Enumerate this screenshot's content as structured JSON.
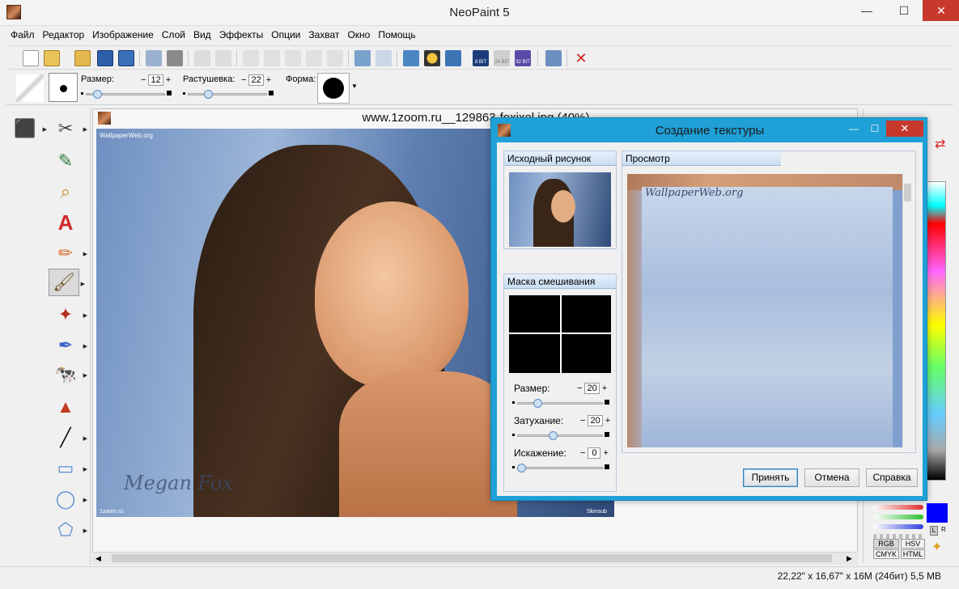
{
  "app": {
    "title": "NeoPaint 5",
    "minimize": "—",
    "maximize": "☐",
    "close": "✕"
  },
  "menu": [
    "Файл",
    "Редактор",
    "Изображение",
    "Слой",
    "Вид",
    "Эффекты",
    "Опции",
    "Захват",
    "Окно",
    "Помощь"
  ],
  "toolbar": {
    "badges": [
      "8 BIT",
      "24 BIT",
      "32 BIT"
    ]
  },
  "options": {
    "size_label": "Размер:",
    "size_value": "12",
    "feather_label": "Растушевка:",
    "feather_value": "22",
    "shape_label": "Форма:",
    "size_slider": 0.1,
    "feather_slider": 0.22
  },
  "document": {
    "title": "www.1zoom.ru__129863-foxixel.jpg (40%)",
    "watermark_top": "WallpaperWeb.org",
    "watermark_name": "Megan Fox",
    "corner_left": "1zoom.ru",
    "corner_right": "Skinsub"
  },
  "dialog": {
    "title": "Создание текстуры",
    "source_label": "Исходный рисунок",
    "preview_label": "Просмотр",
    "mask_label": "Маска смешивания",
    "preview_watermark": "WallpaperWeb.org",
    "size_label": "Размер:",
    "size_value": "20",
    "fade_label": "Затухание:",
    "fade_value": "20",
    "distort_label": "Искажение:",
    "distort_value": "0",
    "size_slider": 0.2,
    "fade_slider": 0.4,
    "distort_slider": 0.0,
    "accept": "Принять",
    "cancel": "Отмена",
    "help": "Справка"
  },
  "color_modes": [
    "RGB",
    "HSV",
    "CMYK",
    "HTML"
  ],
  "color_flags": [
    "L",
    "R"
  ],
  "colors": {
    "foreground": "#000000",
    "background": "#0000ff"
  },
  "status": {
    "text": "22,22\" x 16,67\" x 16M (24бит) 5,5 MB"
  }
}
